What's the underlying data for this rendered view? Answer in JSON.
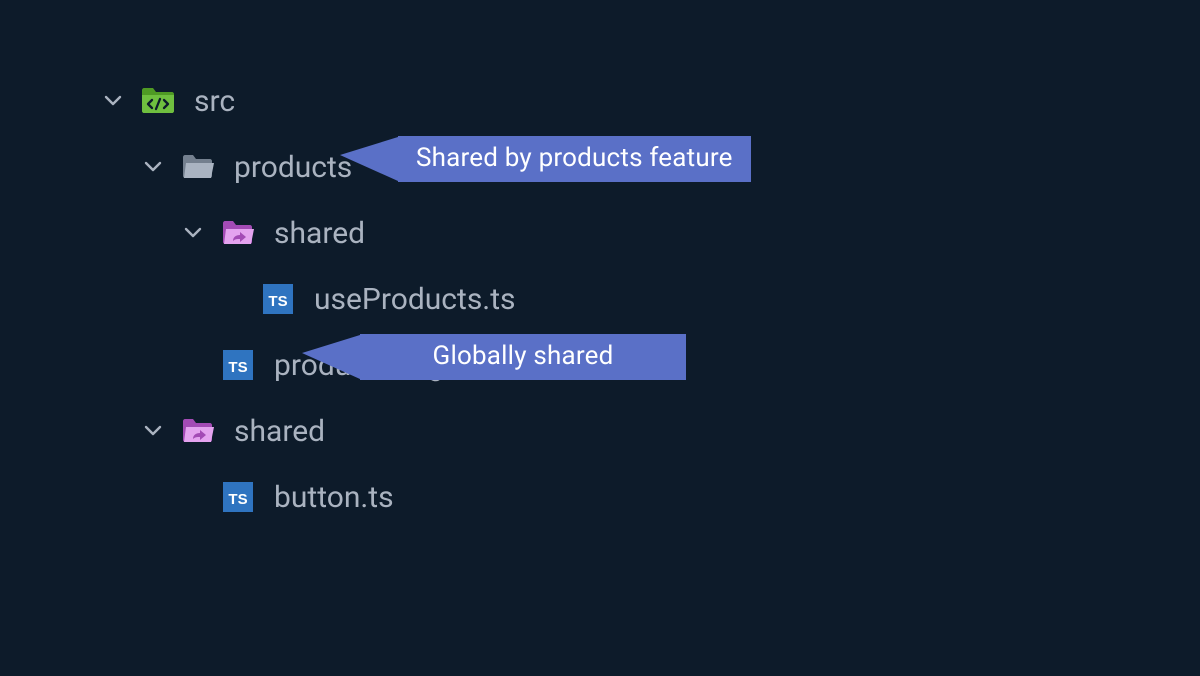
{
  "tree": {
    "src": {
      "label": "src"
    },
    "products": {
      "label": "products"
    },
    "shared_products": {
      "label": "shared"
    },
    "useProducts": {
      "label": "useProducts.ts"
    },
    "productsPage": {
      "label": "productsPage.ts"
    },
    "shared_global": {
      "label": "shared"
    },
    "button": {
      "label": "button.ts"
    }
  },
  "callouts": {
    "products_shared": "Shared by products feature",
    "global_shared": "Globally shared"
  },
  "icons": {
    "ts_badge": "TS"
  },
  "colors": {
    "bg": "#0d1b2a",
    "text": "#aab3c0",
    "chevron": "#aab3c0",
    "src_folder": "#6fbf3f",
    "src_folder_dark": "#4f9a24",
    "grey_folder": "#8e99a8",
    "grey_folder_light": "#aab4c2",
    "shared_folder": "#c768d6",
    "shared_folder_light": "#e4a3ef",
    "ts_bg": "#2f74c0",
    "ts_text": "#ffffff",
    "callout_bg": "#5a70c7",
    "callout_text": "#ffffff"
  }
}
